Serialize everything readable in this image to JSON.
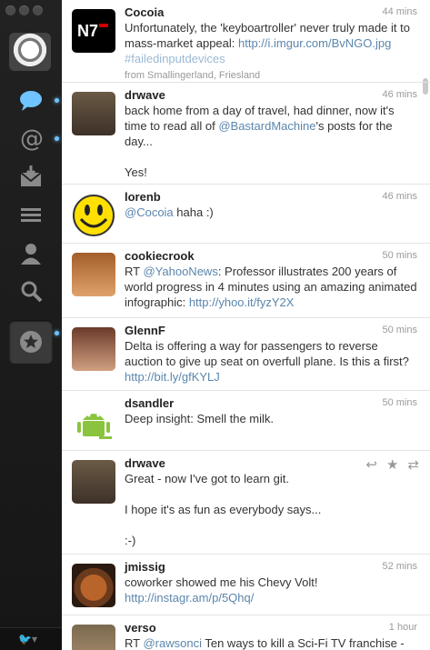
{
  "sidebar": {
    "nav": [
      "timeline-icon",
      "mentions-icon",
      "messages-icon",
      "lists-icon",
      "profile-icon",
      "search-icon",
      "favorites-icon"
    ],
    "bird_label": "🐦▾"
  },
  "tweets": [
    {
      "user": "Cocoia",
      "time": "44 mins",
      "text1": "Unfortunately, the 'keyboartroller' never truly made it to mass-market appeal: ",
      "link": "http://i.imgur.com/BvNGO.jpg",
      "hashtag": "#failedinputdevices",
      "from": "from Smallingerland, Friesland",
      "avatar_text": "N7"
    },
    {
      "user": "drwave",
      "time": "46 mins",
      "text1": "back home from a day of travel, had dinner, now it's time to read all of ",
      "mention": "@BastardMachine",
      "text2": "'s posts for the day...",
      "text3": "Yes!"
    },
    {
      "user": "lorenb",
      "time": "46 mins",
      "mention": "@Cocoia",
      "text1": " haha :)"
    },
    {
      "user": "cookiecrook",
      "time": "50 mins",
      "text1": "RT ",
      "mention": "@YahooNews",
      "text2": ": Professor illustrates 200 years of world progress in 4 minutes using an amazing animated infographic: ",
      "link": "http://yhoo.it/fyzY2X"
    },
    {
      "user": "GlennF",
      "time": "50 mins",
      "text1": "Delta is offering a way for passengers to reverse auction to give up seat on overfull plane. Is this a first? ",
      "link": "http://bit.ly/gfKYLJ"
    },
    {
      "user": "dsandler",
      "time": "50 mins",
      "text1": "Deep insight: Smell the milk."
    },
    {
      "user": "drwave",
      "time": "",
      "text1": "Great - now I've got to learn git.",
      "text2": "I hope it's as fun as everybody says...",
      "text3": ":-)",
      "actions": [
        "reply-icon",
        "favorite-icon",
        "retweet-icon"
      ]
    },
    {
      "user": "jmissig",
      "time": "52 mins",
      "text1": "coworker showed me his Chevy Volt! ",
      "link": "http://instagr.am/p/5Qhq/"
    },
    {
      "user": "verso",
      "time": "1 hour",
      "text1": "RT ",
      "mention": "@rawsonci",
      "text2": " Ten ways to kill a Sci-Fi TV franchise -"
    }
  ]
}
